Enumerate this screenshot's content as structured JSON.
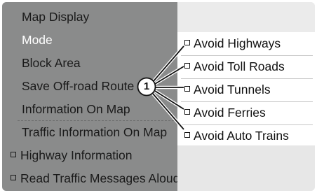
{
  "left_menu": {
    "items": [
      {
        "label": "Map Display"
      },
      {
        "label": "Mode"
      },
      {
        "label": "Block Area"
      },
      {
        "label": "Save Off-road Route"
      },
      {
        "label": "Information On Map"
      },
      {
        "label": "Traffic Information On Map"
      },
      {
        "label": "Highway Information"
      },
      {
        "label": "Read Traffic Messages Aloud"
      }
    ]
  },
  "route_options": {
    "items": [
      {
        "label": "Avoid Highways"
      },
      {
        "label": "Avoid Toll Roads"
      },
      {
        "label": "Avoid Tunnels"
      },
      {
        "label": "Avoid Ferries"
      },
      {
        "label": "Avoid Auto Trains"
      }
    ]
  },
  "callout": {
    "number": "1"
  },
  "colors": {
    "menu_bg": "#8a8b8b",
    "selected_text": "#ffffff",
    "list_bg": "#ffffff"
  }
}
